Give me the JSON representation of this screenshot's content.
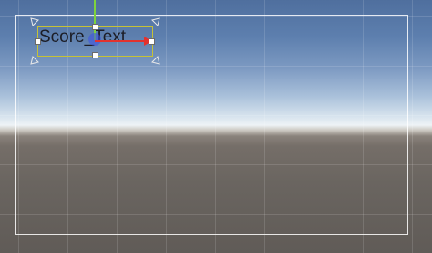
{
  "scene": {
    "selected_object_text": "Score_Text"
  },
  "icons": {
    "anchor": "anchor-icon",
    "y_axis": "y-axis-arrow-icon",
    "x_axis": "x-axis-arrow-icon",
    "pivot": "pivot-icon"
  },
  "colors": {
    "rect_outline": "#c6c236",
    "x_axis": "#e2322e",
    "y_axis": "#7ed33d",
    "pivot": "#3c50e6",
    "canvas_outline": "#ffffff"
  }
}
